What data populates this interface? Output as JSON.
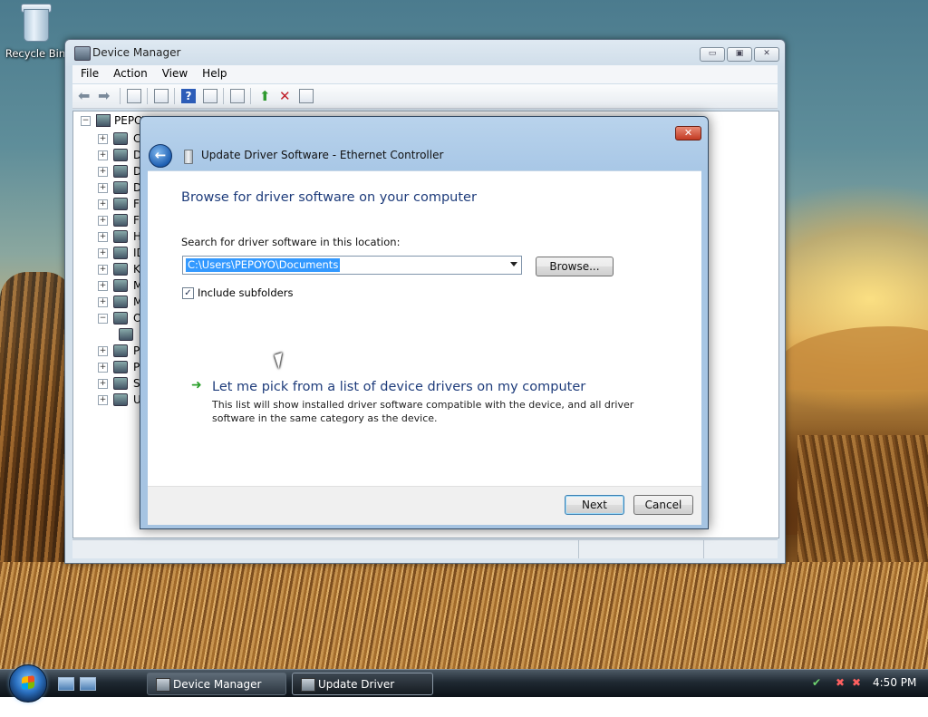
{
  "desktop": {
    "icons": [
      {
        "label": "Recycle Bin",
        "icon": "recycle-bin-icon"
      }
    ]
  },
  "device_manager": {
    "title": "Device Manager",
    "caption_buttons": {
      "minimize": "▭",
      "maximize": "▣",
      "close": "✕"
    },
    "menu": [
      "File",
      "Action",
      "View",
      "Help"
    ],
    "toolbar": [
      "back-icon",
      "forward-icon",
      "properties-icon",
      "page-icon",
      "help-icon",
      "view-icon",
      "scan-hardware-icon",
      "update-driver-icon",
      "uninstall-icon",
      "disable-icon"
    ],
    "tree": {
      "root_label": "PEPOYO",
      "items": [
        {
          "label": "Co",
          "expander": "+"
        },
        {
          "label": "Di",
          "expander": "+"
        },
        {
          "label": "Di",
          "expander": "+"
        },
        {
          "label": "DV",
          "expander": "+"
        },
        {
          "label": "Fl",
          "expander": "+"
        },
        {
          "label": "Fl",
          "expander": "+"
        },
        {
          "label": "Hu",
          "expander": "+"
        },
        {
          "label": "ID",
          "expander": "+"
        },
        {
          "label": "Ke",
          "expander": "+"
        },
        {
          "label": "M",
          "expander": "+"
        },
        {
          "label": "M",
          "expander": "+"
        },
        {
          "label": "Ot",
          "expander": "−"
        },
        {
          "label": "",
          "expander": ""
        },
        {
          "label": "Po",
          "expander": "+"
        },
        {
          "label": "Pr",
          "expander": "+"
        },
        {
          "label": "Sy",
          "expander": "+"
        },
        {
          "label": "Ur",
          "expander": "+"
        }
      ]
    }
  },
  "dialog": {
    "title": "Update Driver Software - Ethernet Controller",
    "close": "✕",
    "back_glyph": "←",
    "heading": "Browse for driver software on your computer",
    "search_label": "Search for driver software in this location:",
    "path_value": "C:\\Users\\PEPOYO\\Documents",
    "browse_label": "Browse...",
    "include_subfolders": {
      "label": "Include subfolders",
      "checked": true,
      "glyph": "✓"
    },
    "pick_link": {
      "arrow": "➜",
      "title": "Let me pick from a list of device drivers on my computer",
      "description": "This list will show installed driver software compatible with the device, and all driver software in the same category as the device."
    },
    "next_label": "Next",
    "cancel_label": "Cancel"
  },
  "taskbar": {
    "buttons": [
      {
        "label": "Device Manager",
        "active": false
      },
      {
        "label": "Update Driver Softw...",
        "active": true
      }
    ],
    "clock": "4:50 PM"
  },
  "colors": {
    "link_blue": "#1e3c7b",
    "selection": "#3399ff",
    "green_arrow": "#2ca02c"
  }
}
